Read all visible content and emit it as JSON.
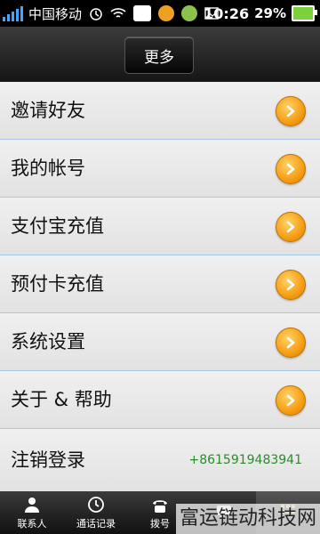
{
  "status_bar": {
    "carrier": "中国移动",
    "time": "10:26",
    "battery": "29%",
    "icons": [
      "signal-icon",
      "alarm-icon",
      "wifi-icon",
      "app-icon",
      "app-icon",
      "app-icon",
      "image-icon",
      "battery-icon"
    ]
  },
  "header": {
    "title": "更多"
  },
  "menu": {
    "items": [
      {
        "label": "邀请好友"
      },
      {
        "label": "我的帐号"
      },
      {
        "label": "支付宝充值"
      },
      {
        "label": "预付卡充值"
      },
      {
        "label": "系统设置"
      },
      {
        "label": "关于 & 帮助"
      }
    ],
    "logout": {
      "label": "注销登录",
      "phone": "+8615919483941"
    }
  },
  "tabs": [
    {
      "label": "联系人",
      "icon": "person-icon"
    },
    {
      "label": "通话记录",
      "icon": "clock-icon"
    },
    {
      "label": "拨号",
      "icon": "dialpad-icon"
    },
    {
      "label": "",
      "icon": "chat-icon"
    },
    {
      "label": "",
      "icon": "grid-icon"
    }
  ],
  "watermark": "富运链动科技网",
  "colors": {
    "accent": "#f7a21a",
    "phone": "#2c8a2c",
    "divider": "#a8c7e8"
  }
}
